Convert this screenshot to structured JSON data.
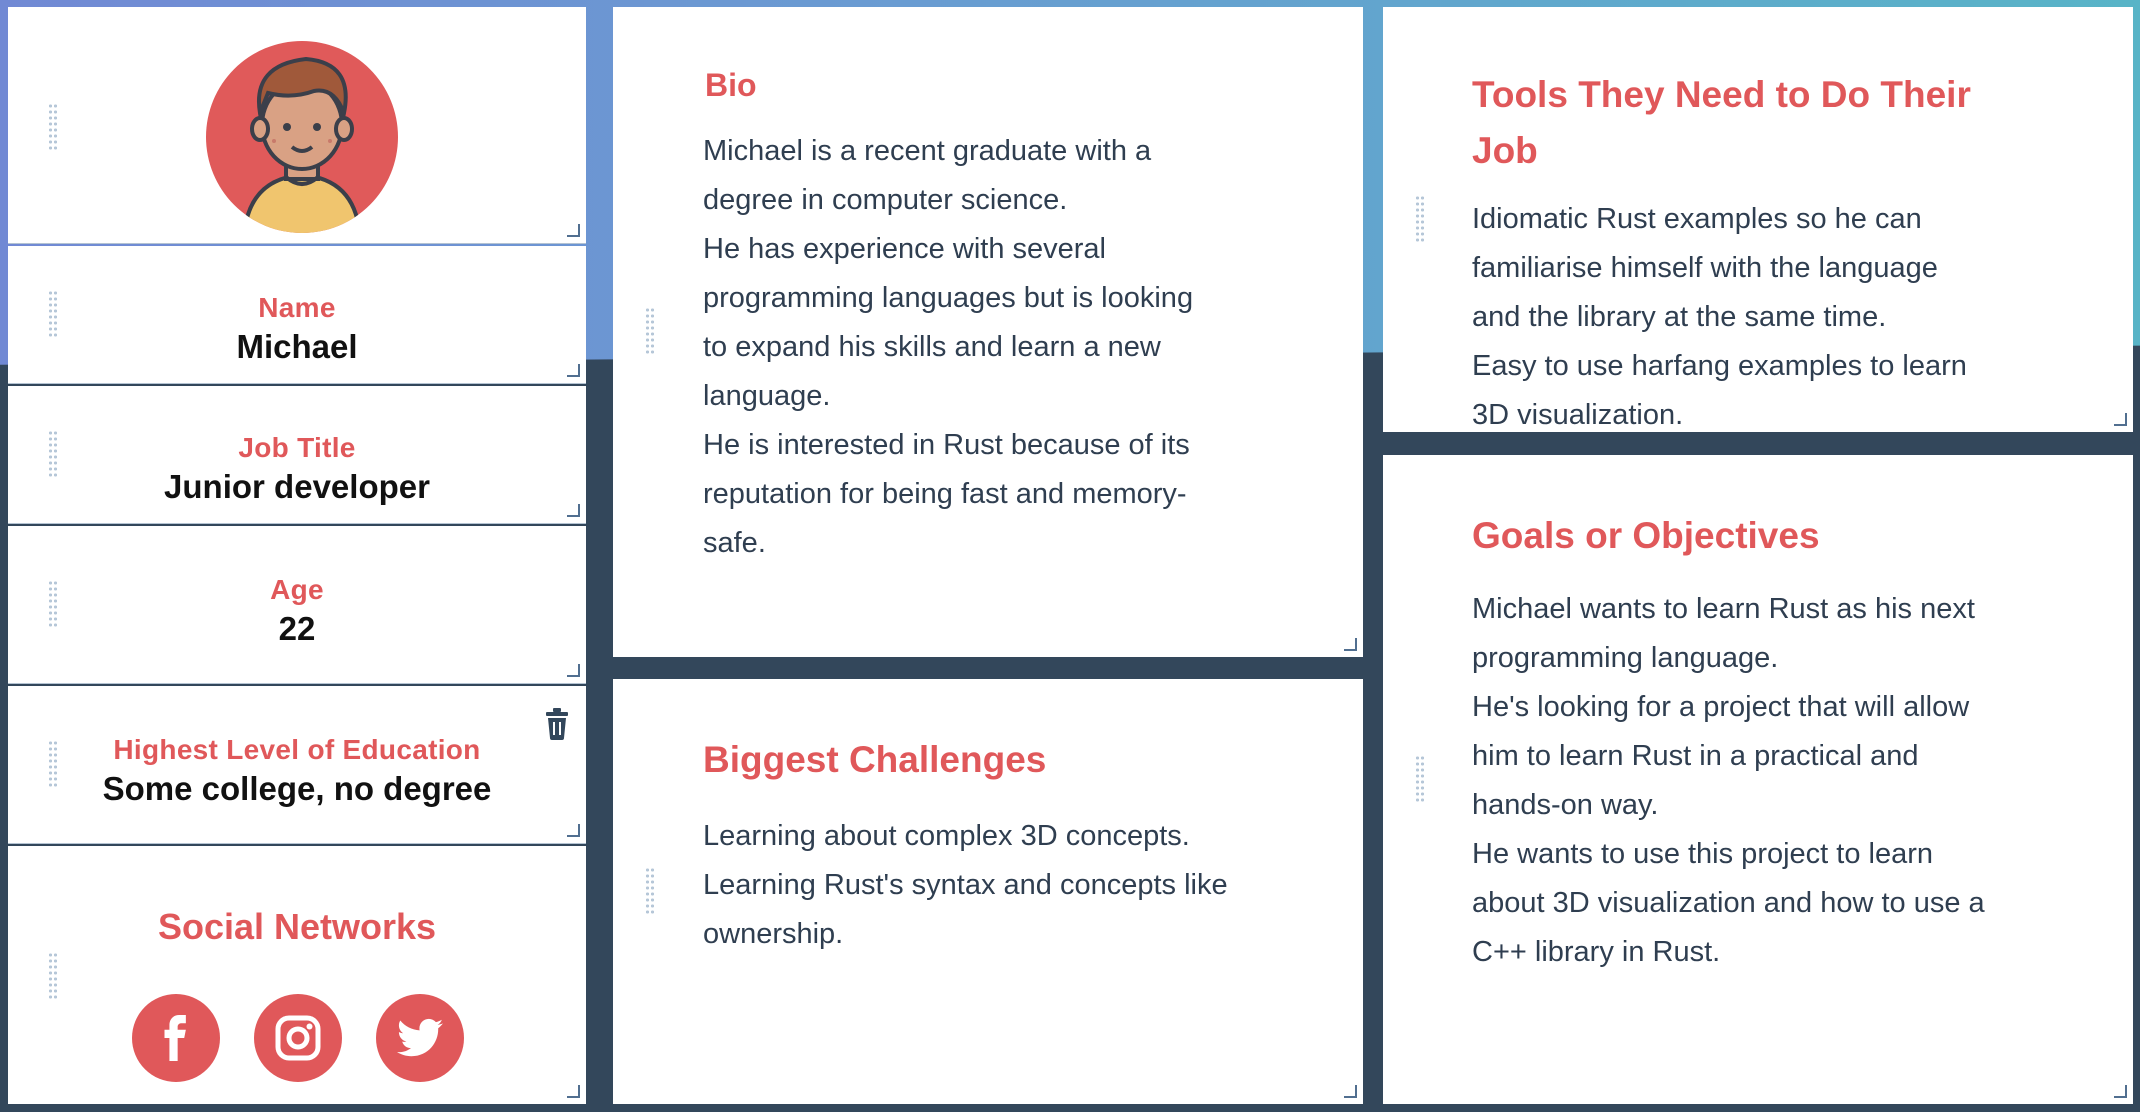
{
  "profile": {
    "avatar_icon": "user-avatar-illustration",
    "name": {
      "label": "Name",
      "value": "Michael"
    },
    "job_title": {
      "label": "Job Title",
      "value": "Junior developer"
    },
    "age": {
      "label": "Age",
      "value": "22"
    },
    "education": {
      "label": "Highest Level of Education",
      "value": "Some college, no degree",
      "delete_icon": "trash-icon"
    },
    "social": {
      "title": "Social Networks",
      "networks": [
        "facebook-icon",
        "instagram-icon",
        "twitter-icon"
      ]
    }
  },
  "bio": {
    "title": "Bio",
    "lines": [
      "Michael is a recent graduate with a",
      "degree in computer science.",
      "He has experience with several",
      "programming languages but is looking",
      "to expand his skills and learn a new",
      "language.",
      "He is interested in Rust because of its",
      "reputation for being fast and memory-",
      "safe."
    ]
  },
  "challenges": {
    "title": "Biggest Challenges",
    "lines": [
      "Learning about complex 3D concepts.",
      "Learning Rust's syntax and concepts like",
      "ownership."
    ]
  },
  "tools": {
    "title_line1": "Tools They Need to Do Their",
    "title_line2": "Job",
    "lines": [
      "Idiomatic Rust examples so he can",
      "familiarise himself with the language",
      "and the library at the same time.",
      "Easy to use harfang examples to learn",
      "3D visualization."
    ]
  },
  "goals": {
    "title": "Goals or Objectives",
    "lines": [
      "Michael wants to learn Rust as his next",
      "programming language.",
      "He's looking for a project that will allow",
      "him to learn Rust in a practical and",
      "hands-on way.",
      "He wants to use this project to learn",
      "about 3D visualization and how to use a",
      "C++ library in Rust."
    ]
  },
  "colors": {
    "accent": "#e0585a",
    "text": "#2f3e50",
    "dark_bg": "#33475b"
  }
}
